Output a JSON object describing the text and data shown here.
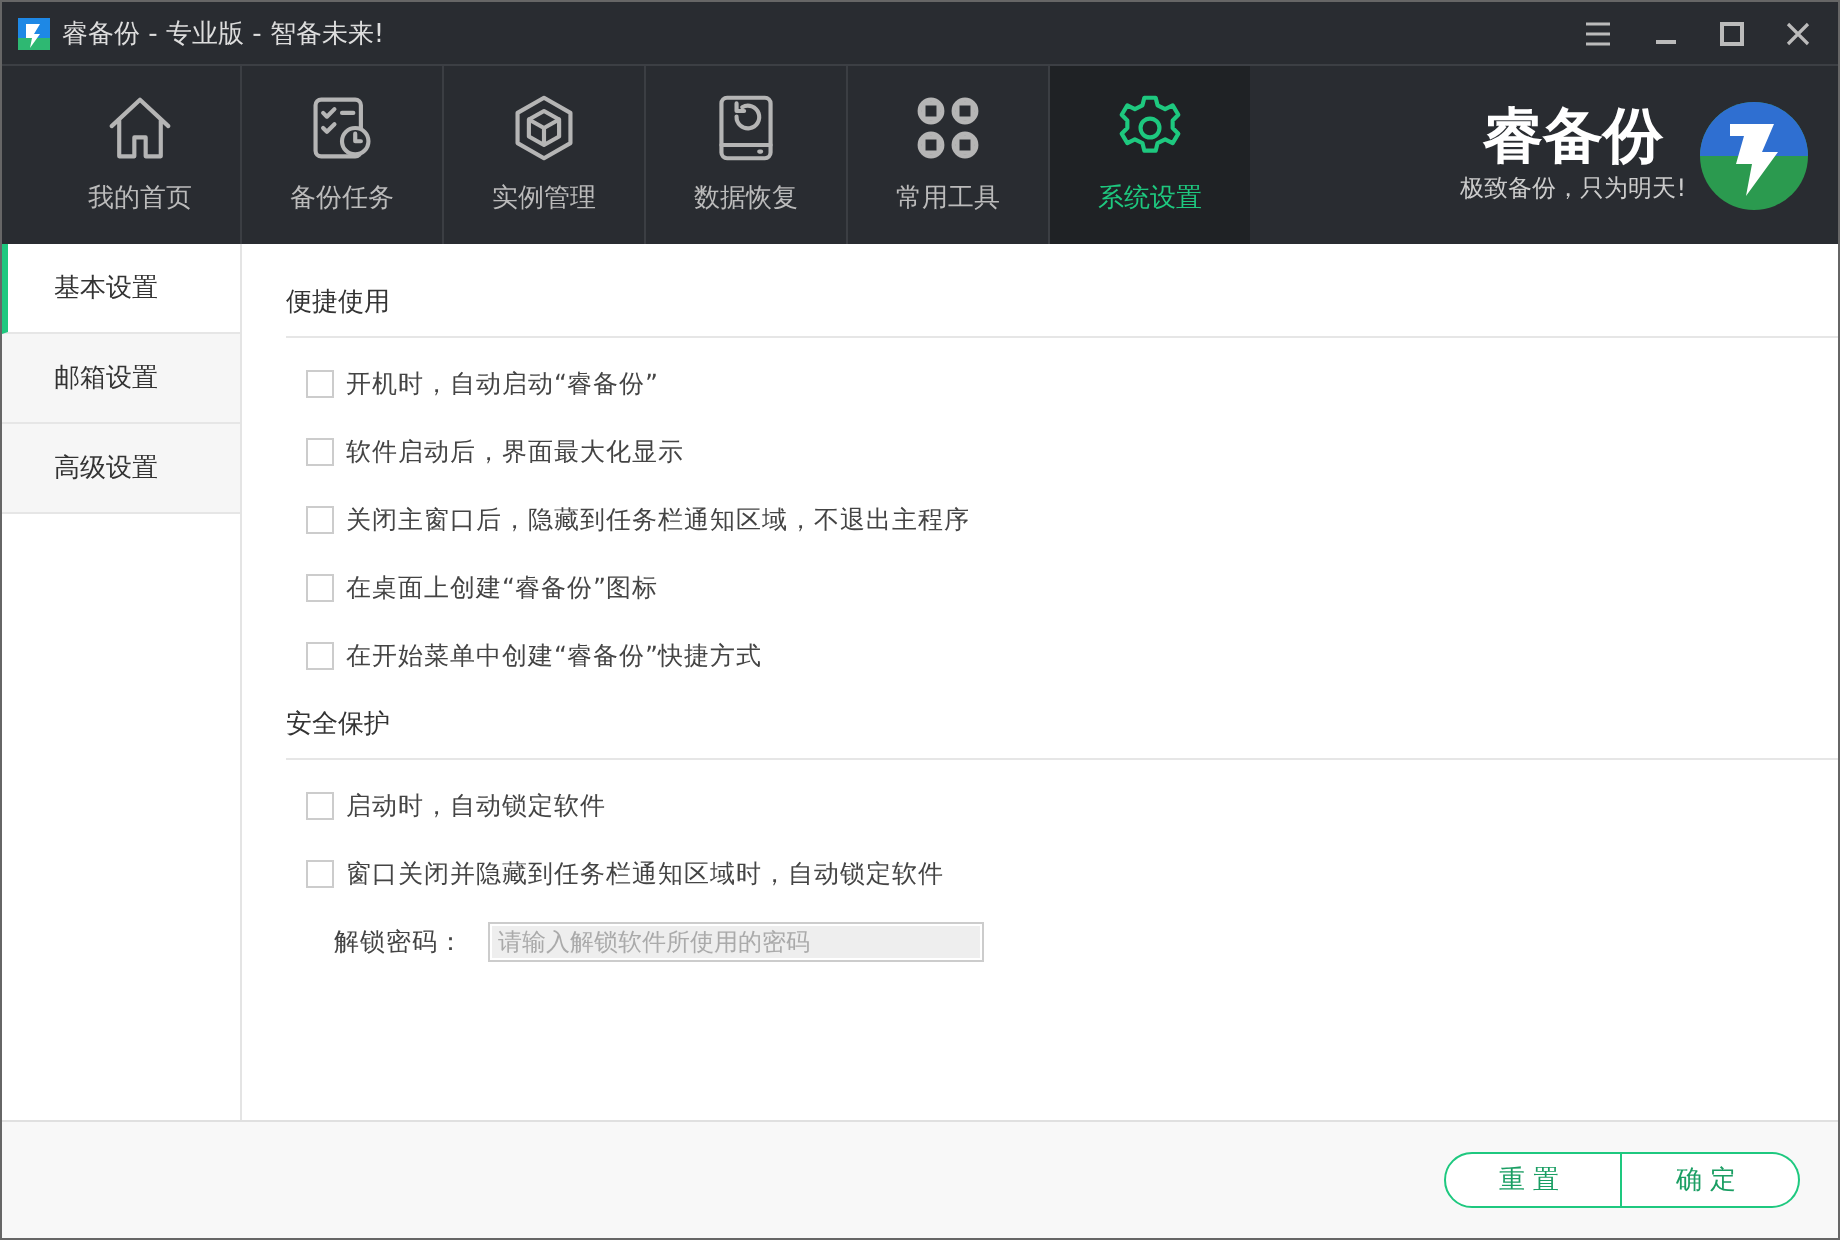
{
  "window": {
    "title": "睿备份 - 专业版 - 智备未来!"
  },
  "nav": [
    {
      "label": "我的首页",
      "kind": "home",
      "selected": false
    },
    {
      "label": "备份任务",
      "kind": "task",
      "selected": false
    },
    {
      "label": "实例管理",
      "kind": "cube",
      "selected": false
    },
    {
      "label": "数据恢复",
      "kind": "restore",
      "selected": false
    },
    {
      "label": "常用工具",
      "kind": "tools",
      "selected": false
    },
    {
      "label": "系统设置",
      "kind": "gear",
      "selected": true
    }
  ],
  "brand": {
    "name": "睿备份",
    "slogan": "极致备份，只为明天!"
  },
  "sidebar": {
    "items": [
      {
        "label": "基本设置",
        "selected": true
      },
      {
        "label": "邮箱设置",
        "selected": false
      },
      {
        "label": "高级设置",
        "selected": false
      }
    ]
  },
  "sections": [
    {
      "title": "便捷使用",
      "options": [
        {
          "label": "开机时，自动启动“睿备份”",
          "checked": false
        },
        {
          "label": "软件启动后，界面最大化显示",
          "checked": false
        },
        {
          "label": "关闭主窗口后，隐藏到任务栏通知区域，不退出主程序",
          "checked": false
        },
        {
          "label": "在桌面上创建“睿备份”图标",
          "checked": false
        },
        {
          "label": "在开始菜单中创建“睿备份”快捷方式",
          "checked": false
        }
      ]
    },
    {
      "title": "安全保护",
      "options": [
        {
          "label": "启动时，自动锁定软件",
          "checked": false
        },
        {
          "label": "窗口关闭并隐藏到任务栏通知区域时，自动锁定软件",
          "checked": false
        }
      ],
      "field": {
        "label": "解锁密码：",
        "placeholder": "请输入解锁软件所使用的密码"
      }
    }
  ],
  "buttons": [
    {
      "label": "重置"
    },
    {
      "label": "确定"
    }
  ]
}
